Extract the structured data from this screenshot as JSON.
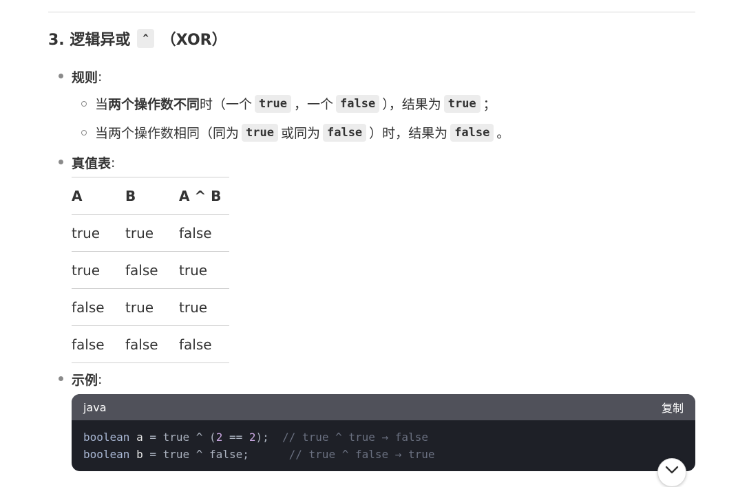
{
  "heading": {
    "prefix": "3. 逻辑异或",
    "op": "^",
    "suffix": "（XOR）"
  },
  "rules": {
    "label": "规则",
    "colon": ":",
    "items": [
      {
        "a": "当",
        "b": "两个操作数不同",
        "c": "时（一个",
        "code1": "true",
        "d": "，一个",
        "code2": "false",
        "e": "），结果为",
        "code3": "true",
        "f": "；"
      },
      {
        "a": "当两个操作数相同（同为",
        "code1": "true",
        "b": "或同为",
        "code2": "false",
        "c": "）时，结果为",
        "code3": "false",
        "d": "。"
      }
    ]
  },
  "truth": {
    "label": "真值表",
    "colon": ":",
    "headers": [
      "A",
      "B",
      "A ^ B"
    ],
    "rows": [
      [
        "true",
        "true",
        "false"
      ],
      [
        "true",
        "false",
        "true"
      ],
      [
        "false",
        "true",
        "true"
      ],
      [
        "false",
        "false",
        "false"
      ]
    ]
  },
  "example": {
    "label": "示例",
    "colon": ":",
    "lang": "java",
    "copy": "复制",
    "lines": [
      {
        "kw": "boolean",
        "var": "a",
        "mid1": " = true ^ (",
        "n1": "2",
        "mid2": " == ",
        "n2": "2",
        "end": ");",
        "cm": "// true ^ true → false"
      },
      {
        "kw": "boolean",
        "var": "b",
        "mid1": " = true ^ false;",
        "cm": "// true ^ false → true"
      }
    ]
  },
  "icons": {
    "scroll": "chevron-down-icon"
  }
}
